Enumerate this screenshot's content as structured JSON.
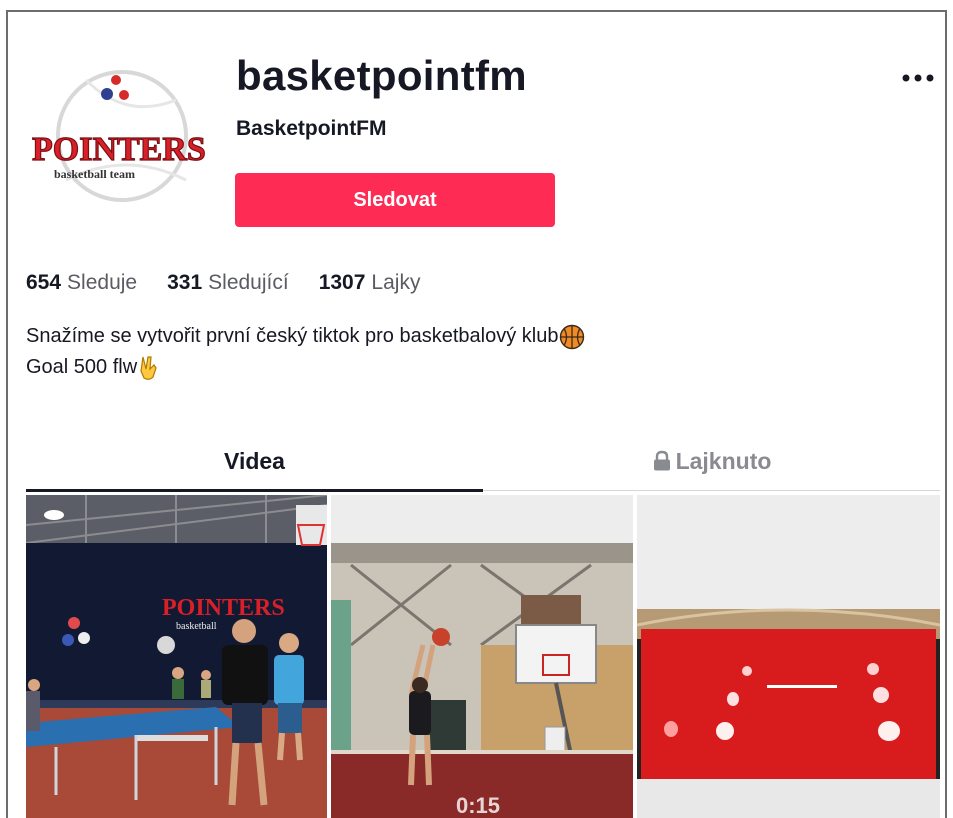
{
  "profile": {
    "handle": "basketpointfm",
    "nickname": "BasketpointFM",
    "follow_label": "Sledovat",
    "avatar": {
      "logo_word": "POINTERS",
      "logo_sub": "basketball team"
    }
  },
  "stats": [
    {
      "value": "654",
      "label": "Sledujе"
    },
    {
      "value": "331",
      "label": "Sledující"
    },
    {
      "value": "1307",
      "label": "Lajky"
    }
  ],
  "bio": {
    "line1": "Snažíme se vytvořit první český tiktok pro basketbalový klub",
    "line2": "Goal 500 flw"
  },
  "tabs": [
    {
      "label": "Videa",
      "active": true
    },
    {
      "label": "Lajknuto",
      "icon": "lock-icon",
      "active": false
    }
  ],
  "videos": [
    {
      "thumbnail": "gym-table-tennis",
      "banner_text": "POINTERS",
      "banner_sub": "basketball"
    },
    {
      "thumbnail": "gym-shooting",
      "overlay_text": "0:15"
    },
    {
      "thumbnail": "red-court-floor"
    }
  ],
  "colors": {
    "accent": "#fe2c55",
    "text": "#161823",
    "muted": "#5b5c63"
  }
}
